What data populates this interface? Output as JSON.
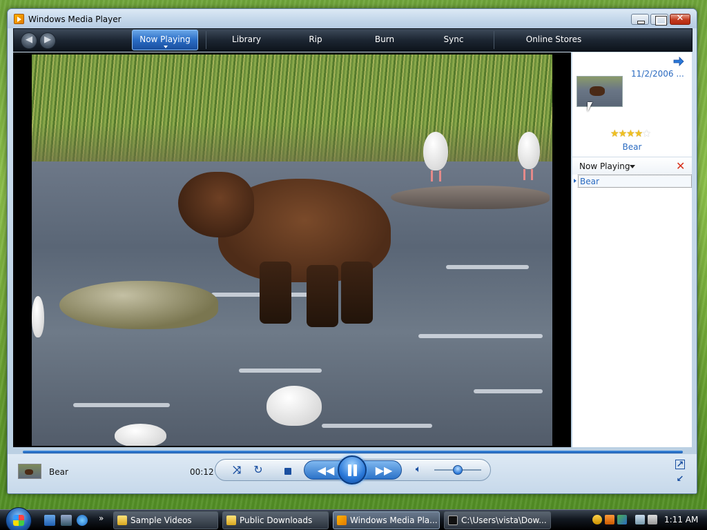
{
  "window": {
    "title": "Windows Media Player"
  },
  "toolbar": {
    "tabs": [
      {
        "label": "Now Playing",
        "active": true
      },
      {
        "label": "Library"
      },
      {
        "label": "Rip"
      },
      {
        "label": "Burn"
      },
      {
        "label": "Sync"
      },
      {
        "label": "Online Stores"
      }
    ]
  },
  "info_pane": {
    "album_date": "11/2/2006 ...",
    "rating_stars": 4,
    "rating_max": 5,
    "album_title": "Bear",
    "list_header": "Now Playing",
    "playlist": [
      "Bear"
    ]
  },
  "controls": {
    "track_name": "Bear",
    "elapsed": "00:12",
    "state": "playing"
  },
  "taskbar": {
    "buttons": [
      {
        "label": "Sample Videos",
        "icon": "folder-icon"
      },
      {
        "label": "Public Downloads",
        "icon": "folder-icon"
      },
      {
        "label": "Windows Media Pla...",
        "icon": "wmp-icon",
        "active": true
      },
      {
        "label": "C:\\Users\\vista\\Dow...",
        "icon": "cmd-icon"
      }
    ],
    "more_label": "»",
    "clock": "1:11 AM"
  },
  "colors": {
    "link_blue": "#2a6ac0",
    "accent_blue": "#2a78d8",
    "toolbar_dark": "#1d2632"
  }
}
